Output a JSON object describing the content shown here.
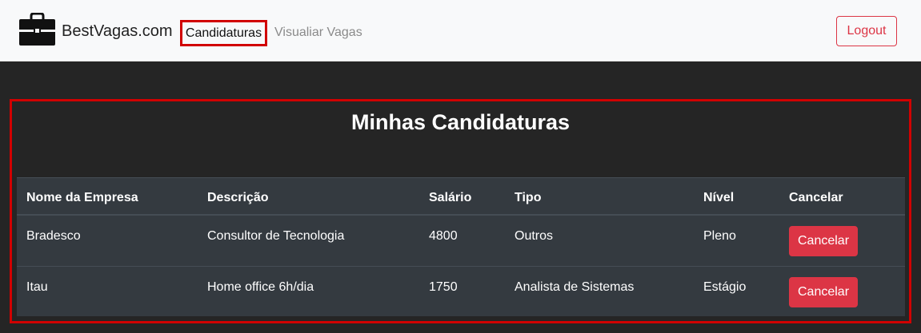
{
  "navbar": {
    "brand": "BestVagas.com",
    "brand_icon": "briefcase-icon",
    "links": [
      {
        "label": "Candidaturas",
        "active": true
      },
      {
        "label": "Visualiar Vagas",
        "active": false
      }
    ],
    "logout_label": "Logout"
  },
  "main": {
    "title": "Minhas Candidaturas",
    "table": {
      "headers": [
        "Nome da Empresa",
        "Descrição",
        "Salário",
        "Tipo",
        "Nível",
        "Cancelar"
      ],
      "rows": [
        {
          "empresa": "Bradesco",
          "descricao": "Consultor de Tecnologia",
          "salario": "4800",
          "tipo": "Outros",
          "nivel": "Pleno",
          "action": "Cancelar"
        },
        {
          "empresa": "Itau",
          "descricao": "Home office 6h/dia",
          "salario": "1750",
          "tipo": "Analista de Sistemas",
          "nivel": "Estágio",
          "action": "Cancelar"
        }
      ]
    }
  },
  "colors": {
    "background": "#252525",
    "navbar": "#f8f9fa",
    "table": "#343a40",
    "danger": "#dc3545",
    "highlight": "#d10000"
  }
}
